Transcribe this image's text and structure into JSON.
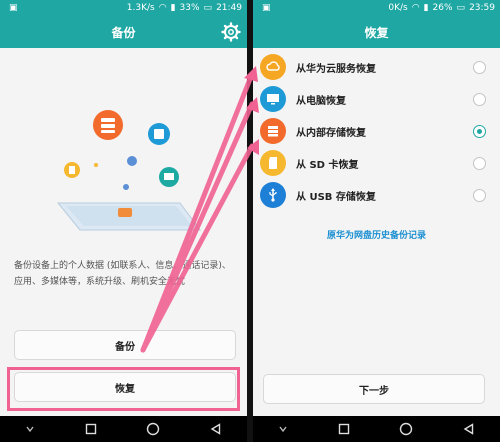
{
  "left": {
    "status": {
      "speed": "1.3K/s",
      "battery": "33%",
      "time": "21:49"
    },
    "title": "备份",
    "description": "备份设备上的个人数据 (如联系人、信息、通话记录)、应用、多媒体等，系统升级、刷机安全无忧",
    "backup_label": "备份",
    "restore_label": "恢复"
  },
  "right": {
    "status": {
      "speed": "0K/s",
      "battery": "26%",
      "time": "23:59"
    },
    "title": "恢复",
    "options": [
      {
        "label": "从华为云服务恢复",
        "icon": "cloud-icon",
        "color": "#f5a623",
        "selected": false
      },
      {
        "label": "从电脑恢复",
        "icon": "computer-icon",
        "color": "#1e9ad6",
        "selected": false
      },
      {
        "label": "从内部存储恢复",
        "icon": "storage-icon",
        "color": "#f26b2d",
        "selected": true
      },
      {
        "label": "从 SD 卡恢复",
        "icon": "sd-card-icon",
        "color": "#f5b82e",
        "selected": false
      },
      {
        "label": "从 USB 存储恢复",
        "icon": "usb-icon",
        "color": "#1e7fd6",
        "selected": false
      }
    ],
    "history_link": "原华为网盘历史备份记录",
    "next_label": "下一步"
  },
  "colors": {
    "accent": "#1fa7a3",
    "annotation": "#f06292",
    "link": "#1a8fd1"
  }
}
